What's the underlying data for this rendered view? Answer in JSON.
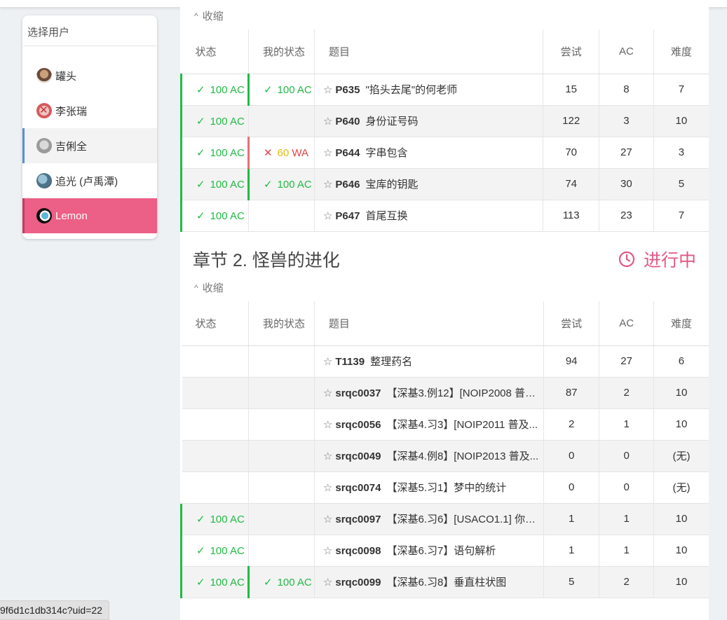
{
  "user_panel": {
    "search_placeholder": "选择用户",
    "users": [
      {
        "name": "罐头",
        "state": "normal"
      },
      {
        "name": "李张瑞",
        "state": "normal"
      },
      {
        "name": "吉俐全",
        "state": "selected"
      },
      {
        "name": "追光 (卢禹潭)",
        "state": "normal"
      },
      {
        "name": "Lemon",
        "state": "highlight"
      }
    ]
  },
  "columns": {
    "status": "状态",
    "my_status": "我的状态",
    "title": "题目",
    "attempts": "尝试",
    "ac": "AC",
    "difficulty": "难度"
  },
  "collapse_label": "收缩",
  "chapter1": {
    "rows": [
      {
        "status": "100 AC",
        "my_status": "100 AC",
        "pid": "P635",
        "name": "\"掐头去尾\"的何老师",
        "attempts": "15",
        "ac": "8",
        "difficulty": "7"
      },
      {
        "status": "100 AC",
        "my_status": "",
        "pid": "P640",
        "name": "身份证号码",
        "attempts": "122",
        "ac": "3",
        "difficulty": "10"
      },
      {
        "status": "100 AC",
        "my_status": "WA",
        "my_score": "60",
        "my_verdict": "WA",
        "pid": "P644",
        "name": "字串包含",
        "attempts": "70",
        "ac": "27",
        "difficulty": "3"
      },
      {
        "status": "100 AC",
        "my_status": "100 AC",
        "pid": "P646",
        "name": "宝库的钥匙",
        "attempts": "74",
        "ac": "30",
        "difficulty": "5"
      },
      {
        "status": "100 AC",
        "my_status": "",
        "pid": "P647",
        "name": "首尾互换",
        "attempts": "113",
        "ac": "23",
        "difficulty": "7"
      }
    ]
  },
  "chapter2": {
    "title": "章节 2. 怪兽的进化",
    "status_label": "进行中",
    "rows": [
      {
        "status": "",
        "my_status": "",
        "pid": "T1139",
        "name": "整理药名",
        "attempts": "94",
        "ac": "27",
        "difficulty": "6"
      },
      {
        "status": "",
        "my_status": "",
        "pid": "srqc0037",
        "name": "【深基3.例12】[NOIP2008 普及...",
        "attempts": "87",
        "ac": "2",
        "difficulty": "10"
      },
      {
        "status": "",
        "my_status": "",
        "pid": "srqc0056",
        "name": "【深基4.习3】[NOIP2011 普及...",
        "attempts": "2",
        "ac": "1",
        "difficulty": "10"
      },
      {
        "status": "",
        "my_status": "",
        "pid": "srqc0049",
        "name": "【深基4.例8】[NOIP2013 普及...",
        "attempts": "0",
        "ac": "0",
        "difficulty": "(无)"
      },
      {
        "status": "",
        "my_status": "",
        "pid": "srqc0074",
        "name": "【深基5.习1】梦中的统计",
        "attempts": "0",
        "ac": "0",
        "difficulty": "(无)"
      },
      {
        "status": "100 AC",
        "my_status": "",
        "pid": "srqc0097",
        "name": "【深基6.习6】[USACO1.1] 你的...",
        "attempts": "1",
        "ac": "1",
        "difficulty": "10"
      },
      {
        "status": "100 AC",
        "my_status": "",
        "pid": "srqc0098",
        "name": "【深基6.习7】语句解析",
        "attempts": "1",
        "ac": "1",
        "difficulty": "10"
      },
      {
        "status": "100 AC",
        "my_status": "100 AC",
        "pid": "srqc0099",
        "name": "【深基6.习8】垂直柱状图",
        "attempts": "5",
        "ac": "2",
        "difficulty": "10"
      }
    ]
  },
  "status_url": "9f6d1c1db314c?uid=22",
  "colors": {
    "accent_pink": "#ec5f86",
    "ac_green": "#21ba45",
    "wa_red": "#e04444",
    "wa_yellow": "#e8b90f",
    "selected_blue": "#5b8ed6"
  },
  "icons": {
    "check": "check-icon",
    "cross": "cross-icon",
    "star": "star-outline-icon",
    "caret": "caret-up-icon",
    "clock": "clock-icon"
  }
}
